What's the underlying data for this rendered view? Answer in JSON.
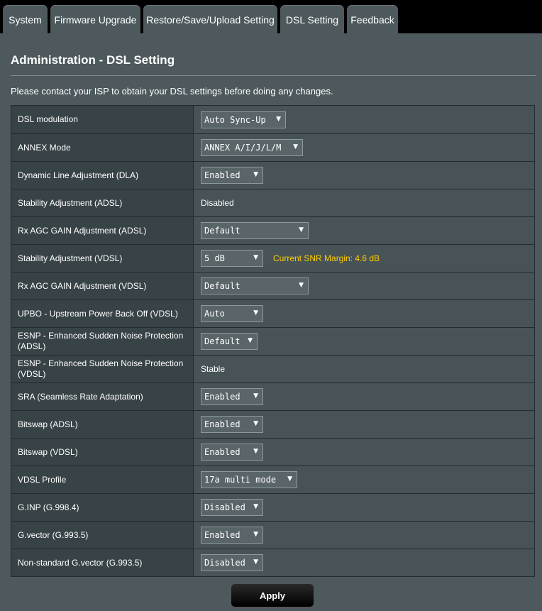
{
  "tabs": [
    {
      "label": "System"
    },
    {
      "label": "Firmware Upgrade"
    },
    {
      "label": "Restore/Save/Upload Setting"
    },
    {
      "label": "DSL Setting"
    },
    {
      "label": "Feedback"
    }
  ],
  "header": {
    "title": "Administration - DSL Setting",
    "description": "Please contact your ISP to obtain your DSL settings before doing any changes."
  },
  "settings": [
    {
      "label": "DSL modulation",
      "value": "Auto Sync-Up"
    },
    {
      "label": "ANNEX Mode",
      "value": "ANNEX A/I/J/L/M"
    },
    {
      "label": "Dynamic Line Adjustment (DLA)",
      "value": "Enabled"
    },
    {
      "label": "Stability Adjustment (ADSL)",
      "value": "Disabled"
    },
    {
      "label": "Rx AGC GAIN Adjustment (ADSL)",
      "value": "Default"
    },
    {
      "label": "Stability Adjustment (VDSL)",
      "value": "5 dB",
      "hint": "Current SNR Margin: 4.6 dB"
    },
    {
      "label": "Rx AGC GAIN Adjustment (VDSL)",
      "value": "Default"
    },
    {
      "label": "UPBO - Upstream Power Back Off (VDSL)",
      "value": "Auto"
    },
    {
      "label": "ESNP - Enhanced Sudden Noise Protection (ADSL)",
      "value": "Default"
    },
    {
      "label": "ESNP - Enhanced Sudden Noise Protection (VDSL)",
      "value": "Stable"
    },
    {
      "label": "SRA (Seamless Rate Adaptation)",
      "value": "Enabled"
    },
    {
      "label": "Bitswap (ADSL)",
      "value": "Enabled"
    },
    {
      "label": "Bitswap (VDSL)",
      "value": "Enabled"
    },
    {
      "label": "VDSL Profile",
      "value": "17a multi mode"
    },
    {
      "label": "G.INP (G.998.4)",
      "value": "Disabled"
    },
    {
      "label": "G.vector (G.993.5)",
      "value": "Enabled"
    },
    {
      "label": "Non-standard G.vector (G.993.5)",
      "value": "Disabled"
    }
  ],
  "apply_label": "Apply",
  "colors": {
    "hint": "#ffcc00",
    "panel_bg": "#4d595d",
    "label_bg": "#384347",
    "value_bg": "#475357"
  }
}
